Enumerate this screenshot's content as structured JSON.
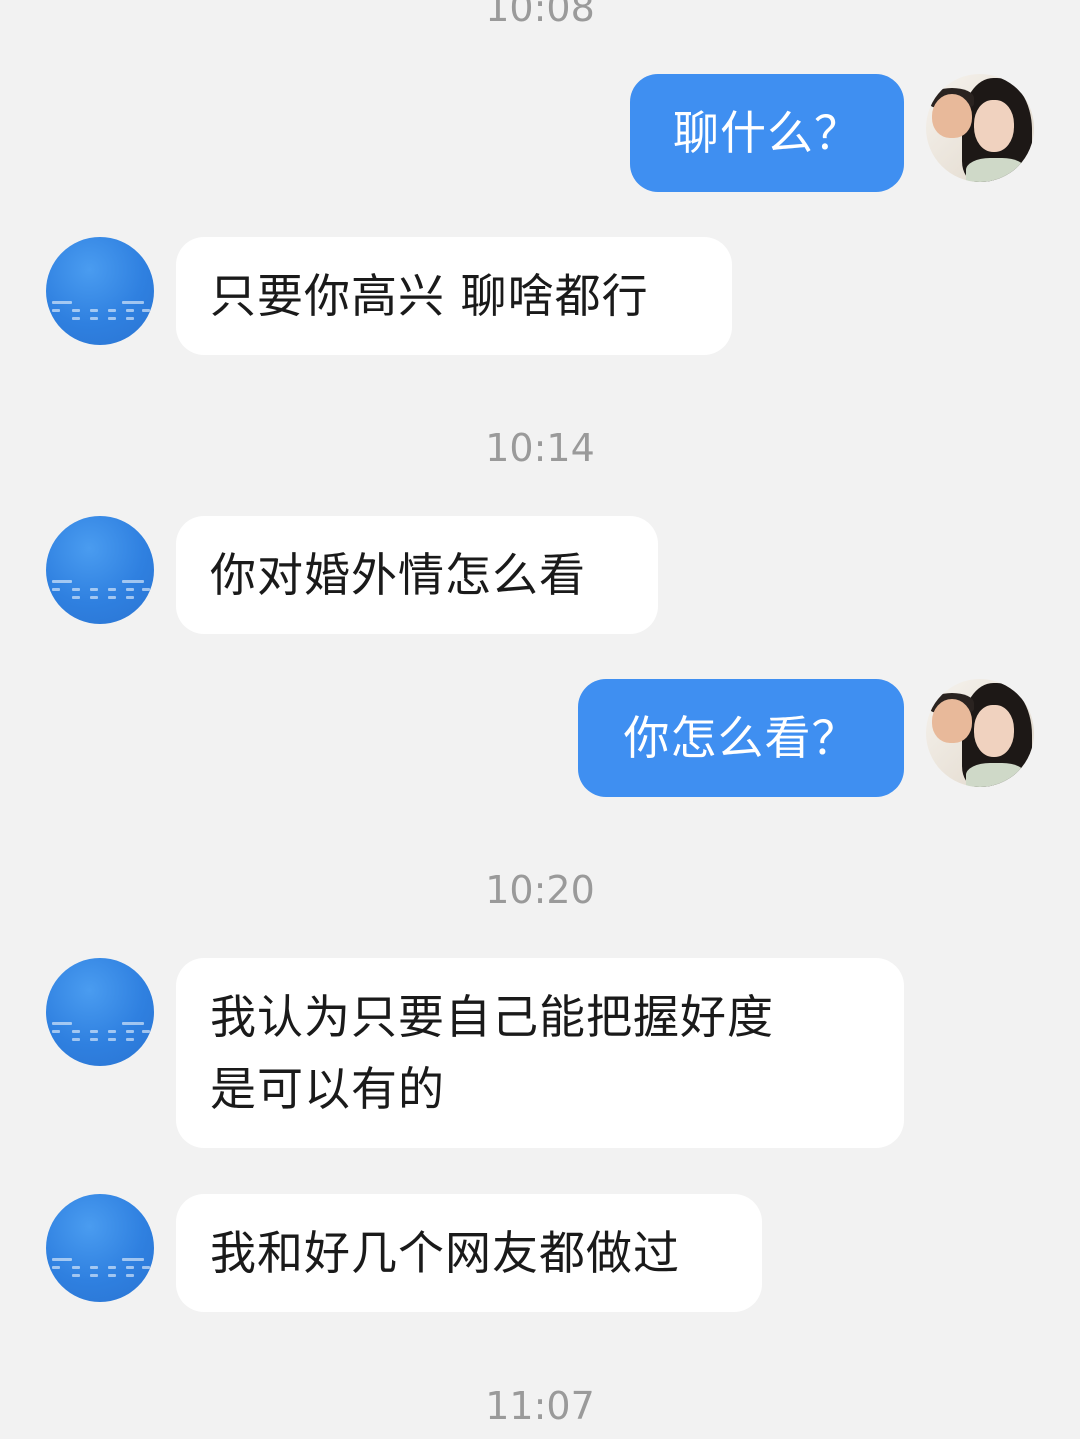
{
  "colors": {
    "background": "#f2f2f2",
    "incoming_bubble": "#ffffff",
    "outgoing_bubble": "#3f8ff1",
    "timestamp_text": "#9a9a9a"
  },
  "timestamps": {
    "t1": "10:08",
    "t2": "10:14",
    "t3": "10:20",
    "t4": "11:07"
  },
  "messages": [
    {
      "side": "outgoing",
      "text": "聊什么？"
    },
    {
      "side": "incoming",
      "text": "只要你高兴  聊啥都行"
    },
    {
      "side": "incoming",
      "text": "你对婚外情怎么看"
    },
    {
      "side": "outgoing",
      "text": "你怎么看？"
    },
    {
      "side": "incoming",
      "text": "我认为只要自己能把握好度\n是可以有的"
    },
    {
      "side": "incoming",
      "text": "我和好几个网友都做过"
    }
  ],
  "avatars": {
    "contact": "weather-screenshot-avatar",
    "self": "couple-photo-avatar"
  }
}
